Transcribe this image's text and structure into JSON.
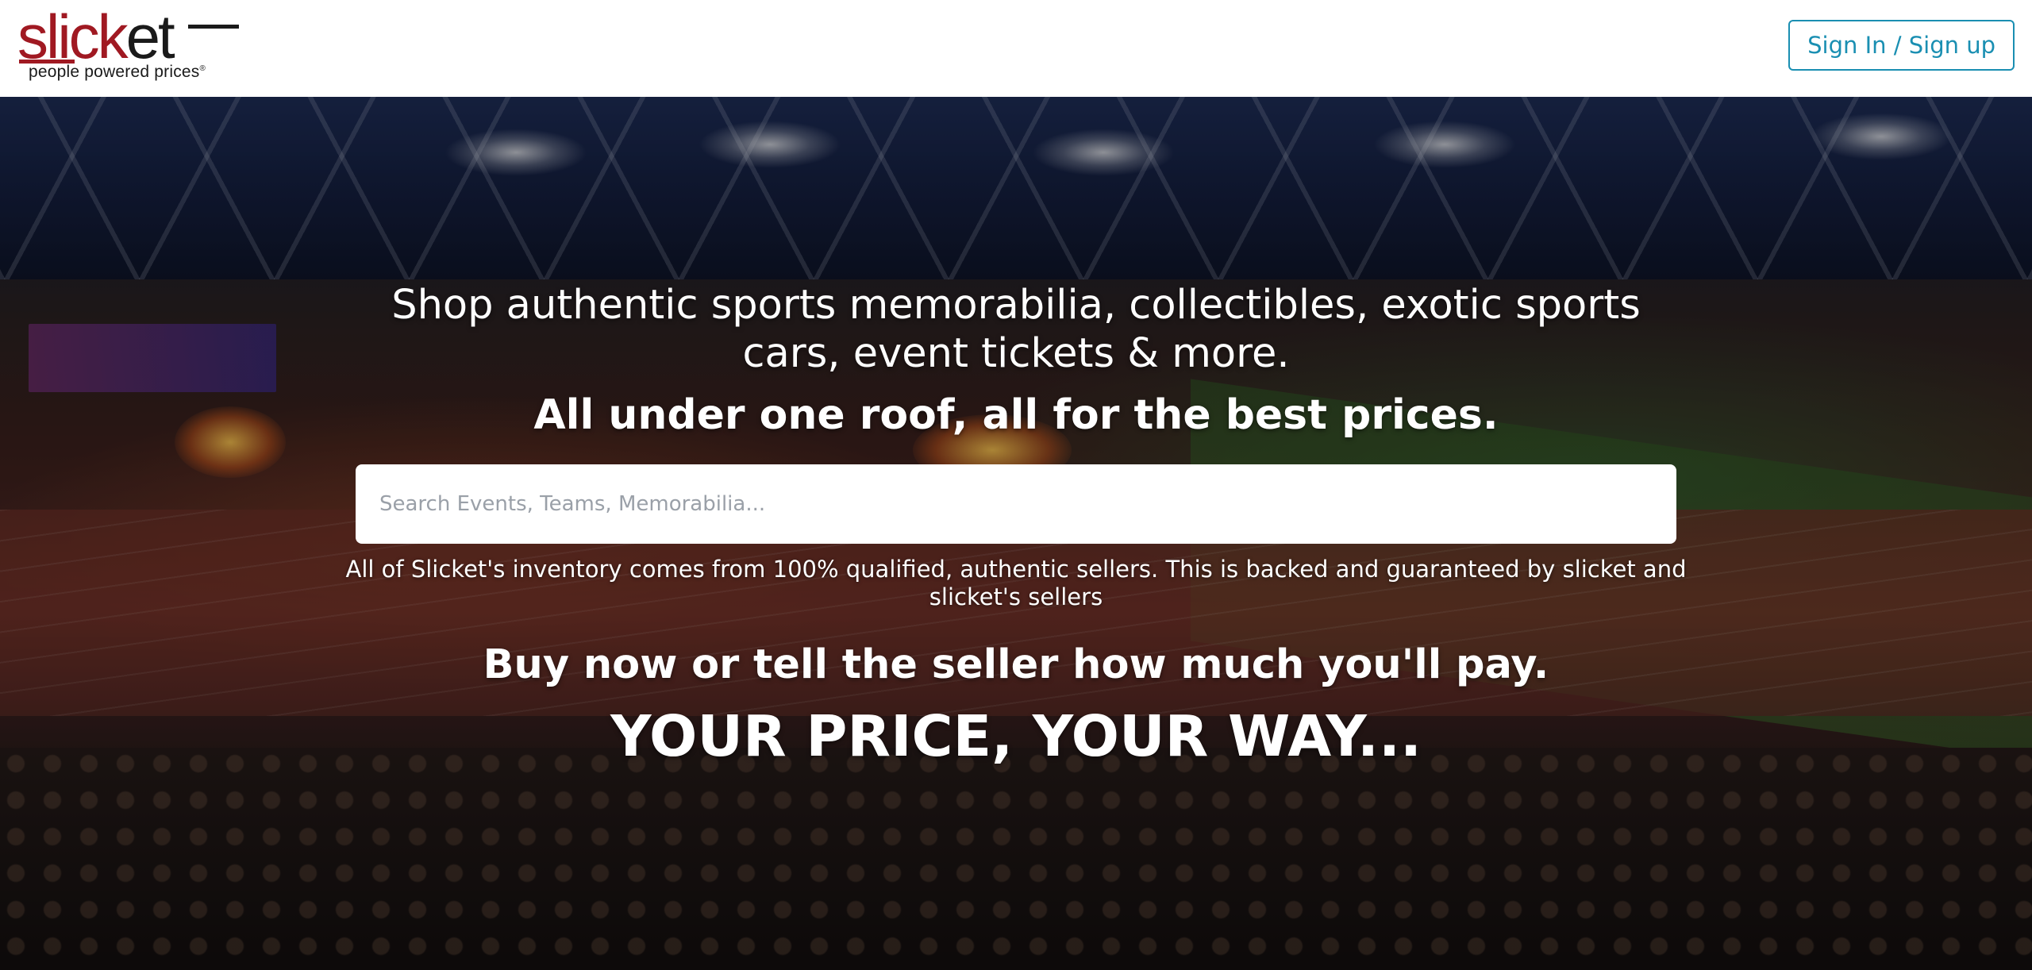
{
  "header": {
    "logo": {
      "wordmark_prefix": "slick",
      "wordmark_suffix": "et",
      "tagline": "people powered prices",
      "registered_mark": "®",
      "brand_dark": "#1a1a1a",
      "brand_red": "#a01922"
    },
    "signin_label": "Sign In / Sign up",
    "signin_color": "#1a8fb2"
  },
  "hero": {
    "headline": "Shop authentic sports memorabilia, collectibles, exotic sports cars, event tickets & more.",
    "subheadline": "All under one roof, all for the best prices.",
    "search": {
      "placeholder": "Search Events, Teams, Memorabilia...",
      "value": ""
    },
    "disclaimer": "All of Slicket's inventory comes from 100% qualified, authentic sellers. This is backed and guaranteed by slicket and slicket's sellers",
    "tagline": "Buy now or tell the seller how much you'll pay.",
    "slogan": "YOUR PRICE, YOUR WAY..."
  }
}
